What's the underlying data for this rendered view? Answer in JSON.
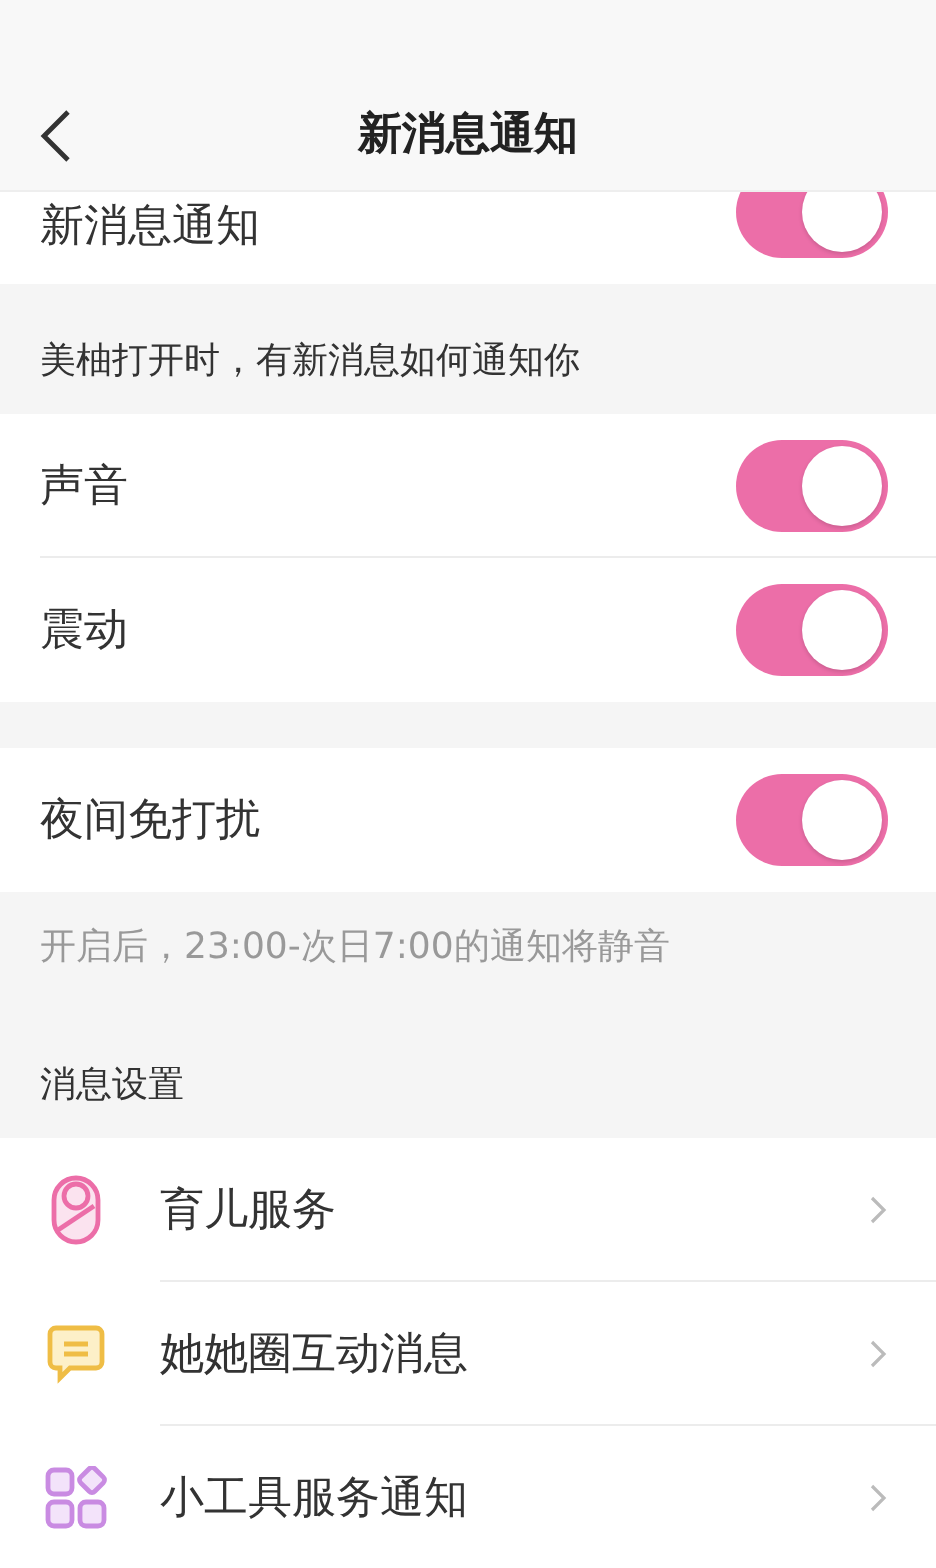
{
  "header": {
    "title": "新消息通知"
  },
  "groups": [
    {
      "rows": [
        {
          "kind": "toggle",
          "label": "新消息通知",
          "on": true
        }
      ]
    },
    {
      "caption": "美柚打开时，有新消息如何通知你",
      "rows": [
        {
          "kind": "toggle",
          "label": "声音",
          "on": true
        },
        {
          "kind": "toggle",
          "label": "震动",
          "on": true
        }
      ]
    },
    {
      "rows": [
        {
          "kind": "toggle",
          "label": "夜间免打扰",
          "on": true
        }
      ],
      "hint": "开启后，23:00-次日7:00的通知将静音"
    },
    {
      "caption": "消息设置",
      "rows": [
        {
          "kind": "link",
          "label": "育儿服务"
        },
        {
          "kind": "link",
          "label": "她她圈互动消息"
        },
        {
          "kind": "link",
          "label": "小工具服务通知"
        }
      ]
    }
  ]
}
